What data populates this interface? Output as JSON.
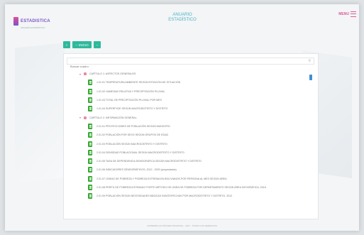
{
  "header": {
    "logo_text": "ESTADISTICA",
    "logo_sub": "ANUARIO ESTADÍSTICO",
    "title_line1": "ANUARIO",
    "title_line2": "ESTADÍSTICO",
    "menu_label": "MENU"
  },
  "toolbar": {
    "btn_plus": "+",
    "btn_minus": "−",
    "btn_main": "INICIO"
  },
  "search": {
    "placeholder": "Buscar cuadro"
  },
  "tree": [
    {
      "type": "cat",
      "label": "CAPÍTULO 1: ASPECTOS GENERALES"
    },
    {
      "type": "item",
      "label": "1.01.01 TEMPERATURA AMBIENTE SEGÚN ESTACIÓN DE SITUACIÓN"
    },
    {
      "type": "item",
      "label": "1.01.02 HUMEDAD RELATIVA Y PRECIPITACIÓN PLUVIAL"
    },
    {
      "type": "item",
      "label": "1.01.03 TOTAL DE PRECIPITACIÓN PLUVIAL POR MES"
    },
    {
      "type": "item",
      "label": "1.01.04 SUPERFICIE SEGÚN MACRODISTRITO Y DISTRITO"
    },
    {
      "type": "cat",
      "label": "CAPÍTULO 2: INFORMACIÓN GENERAL"
    },
    {
      "type": "item",
      "label": "2.01.01 PROYECCIONES DE POBLACIÓN SEGÚN MUNICIPIO"
    },
    {
      "type": "item",
      "label": "2.01.02 POBLACIÓN POR SEXO SEGÚN GRUPOS DE EDAD"
    },
    {
      "type": "item",
      "label": "2.01.03 POBLACIÓN SEGÚN MACRODISTRITO Y DISTRITO"
    },
    {
      "type": "item",
      "label": "2.01.04 DENSIDAD POBLACIONAL SEGÚN MACRODISTRITO Y DISTRITO"
    },
    {
      "type": "item",
      "label": "2.01.05 TASA DE DEPENDENCIA DEMOGRÁFICA SEGÚN MACRODISTRITO Y DISTRITO"
    },
    {
      "type": "item",
      "label": "2.01.06 INDICADORES DEMOGRÁFICOS, 2012 - 2020 (proyectados)"
    },
    {
      "type": "item",
      "label": "2.01.07 LÍNEAS DE POBREZA Y POBREZA EXTREMA EN BOLIVIANOS POR PERSONA AL MES SEGÚN ÁREA"
    },
    {
      "type": "item",
      "label": "2.01.08 PERFIL DE POBREZA ESTIMADO PORTE MÉTODO DE LÍNEA DE POBREZA POR DEPARTAMENTO SEGÚN ÁREA GEOGRÁFICA, 2016"
    },
    {
      "type": "item",
      "label": "2.01.09 POBLACIÓN SEGÚN NECESIDADES BÁSICAS INSATISFECHAS POR MACRODISTRITO Y DISTRITO, 2012"
    }
  ],
  "footer": {
    "text": "GOBIERNO AUTÓNOMO MUNICIPAL · 2017 · TODOS LOS DERECHOS"
  },
  "colors": {
    "accent_green": "#2fb99c",
    "file_green": "#39a935",
    "header_blue": "#4fb2c8",
    "menu_pink": "#e05a99",
    "scroll_blue": "#3d8fd6"
  }
}
